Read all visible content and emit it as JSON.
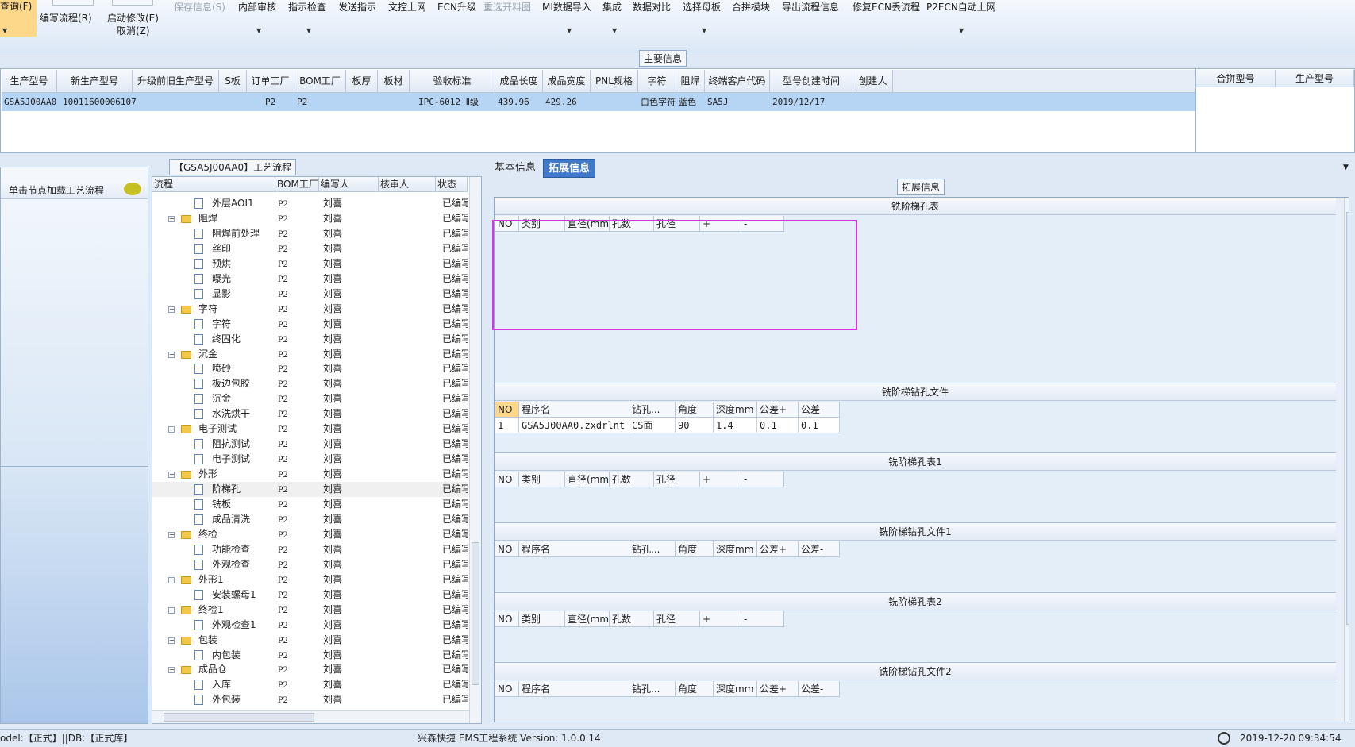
{
  "toolbar": {
    "row1": [
      {
        "label": "查询(F)"
      },
      {
        "label": "编写流程(R)"
      },
      {
        "label": "启动修改(E)"
      },
      {
        "label": "保存信息(S)",
        "disabled": true
      },
      {
        "label": "内部审核"
      },
      {
        "label": "指示检查"
      },
      {
        "label": "发送指示"
      },
      {
        "label": "文控上网"
      },
      {
        "label": "ECN升级"
      },
      {
        "label": "重选开料图",
        "disabled": true
      },
      {
        "label": "MI数据导入"
      },
      {
        "label": "集成"
      },
      {
        "label": "数据对比"
      },
      {
        "label": "选择母板"
      },
      {
        "label": "合拼模块"
      },
      {
        "label": "导出流程信息"
      },
      {
        "label": "修复ECN丢流程"
      },
      {
        "label": "P2ECN自动上网"
      }
    ],
    "cancel": "取消(Z)"
  },
  "main_info": {
    "title": "主要信息",
    "columns": [
      "生产型号",
      "新生产型号",
      "升级前旧生产型号",
      "S板",
      "订单工厂",
      "BOM工厂",
      "板厚",
      "板材",
      "验收标准",
      "成品长度",
      "成品宽度",
      "PNL规格",
      "字符",
      "阻焊",
      "终端客户代码",
      "型号创建时间",
      "创建人"
    ],
    "row": [
      "GSA5J00AA0",
      "10011600006107",
      "",
      "",
      "P2",
      "P2",
      "",
      "",
      "IPC-6012 Ⅱ级",
      "439.96",
      "429.26",
      "",
      "白色字符",
      "蓝色",
      "SA5J",
      "2019/12/17",
      ""
    ],
    "side_columns": [
      "合拼型号",
      "生产型号"
    ]
  },
  "left_panel": {
    "title": "单击节点加载工艺流程"
  },
  "process_tree": {
    "title": "【GSA5J00AA0】工艺流程",
    "columns": [
      "流程",
      "BOM工厂",
      "编写人",
      "核审人",
      "状态"
    ],
    "rows": [
      {
        "type": "doc",
        "name": "外层AOI1",
        "bom": "P2",
        "writer": "刘喜",
        "status": "已编写"
      },
      {
        "type": "folder",
        "name": "阻焊",
        "bom": "P2",
        "writer": "刘喜",
        "status": "已编写"
      },
      {
        "type": "doc",
        "name": "阻焊前处理",
        "bom": "P2",
        "writer": "刘喜",
        "status": "已编写"
      },
      {
        "type": "doc",
        "name": "丝印",
        "bom": "P2",
        "writer": "刘喜",
        "status": "已编写"
      },
      {
        "type": "doc",
        "name": "预烘",
        "bom": "P2",
        "writer": "刘喜",
        "status": "已编写"
      },
      {
        "type": "doc",
        "name": "曝光",
        "bom": "P2",
        "writer": "刘喜",
        "status": "已编写"
      },
      {
        "type": "doc",
        "name": "显影",
        "bom": "P2",
        "writer": "刘喜",
        "status": "已编写"
      },
      {
        "type": "folder",
        "name": "字符",
        "bom": "P2",
        "writer": "刘喜",
        "status": "已编写"
      },
      {
        "type": "doc",
        "name": "字符",
        "bom": "P2",
        "writer": "刘喜",
        "status": "已编写"
      },
      {
        "type": "doc",
        "name": "终固化",
        "bom": "P2",
        "writer": "刘喜",
        "status": "已编写"
      },
      {
        "type": "folder",
        "name": "沉金",
        "bom": "P2",
        "writer": "刘喜",
        "status": "已编写"
      },
      {
        "type": "doc",
        "name": "喷砂",
        "bom": "P2",
        "writer": "刘喜",
        "status": "已编写"
      },
      {
        "type": "doc",
        "name": "板边包胶",
        "bom": "P2",
        "writer": "刘喜",
        "status": "已编写"
      },
      {
        "type": "doc",
        "name": "沉金",
        "bom": "P2",
        "writer": "刘喜",
        "status": "已编写"
      },
      {
        "type": "doc",
        "name": "水洗烘干",
        "bom": "P2",
        "writer": "刘喜",
        "status": "已编写"
      },
      {
        "type": "folder",
        "name": "电子测试",
        "bom": "P2",
        "writer": "刘喜",
        "status": "已编写"
      },
      {
        "type": "doc",
        "name": "阻抗测试",
        "bom": "P2",
        "writer": "刘喜",
        "status": "已编写"
      },
      {
        "type": "doc",
        "name": "电子测试",
        "bom": "P2",
        "writer": "刘喜",
        "status": "已编写"
      },
      {
        "type": "folder",
        "name": "外形",
        "bom": "P2",
        "writer": "刘喜",
        "status": "已编写"
      },
      {
        "type": "doc",
        "name": "阶梯孔",
        "bom": "P2",
        "writer": "刘喜",
        "status": "已编写",
        "selected": true
      },
      {
        "type": "doc",
        "name": "铣板",
        "bom": "P2",
        "writer": "刘喜",
        "status": "已编写"
      },
      {
        "type": "doc",
        "name": "成品清洗",
        "bom": "P2",
        "writer": "刘喜",
        "status": "已编写"
      },
      {
        "type": "folder",
        "name": "终检",
        "bom": "P2",
        "writer": "刘喜",
        "status": "已编写"
      },
      {
        "type": "doc",
        "name": "功能检查",
        "bom": "P2",
        "writer": "刘喜",
        "status": "已编写"
      },
      {
        "type": "doc",
        "name": "外观检查",
        "bom": "P2",
        "writer": "刘喜",
        "status": "已编写"
      },
      {
        "type": "folder",
        "name": "外形1",
        "bom": "P2",
        "writer": "刘喜",
        "status": "已编写"
      },
      {
        "type": "doc",
        "name": "安装螺母1",
        "bom": "P2",
        "writer": "刘喜",
        "status": "已编写"
      },
      {
        "type": "folder",
        "name": "终检1",
        "bom": "P2",
        "writer": "刘喜",
        "status": "已编写"
      },
      {
        "type": "doc",
        "name": "外观检查1",
        "bom": "P2",
        "writer": "刘喜",
        "status": "已编写"
      },
      {
        "type": "folder",
        "name": "包装",
        "bom": "P2",
        "writer": "刘喜",
        "status": "已编写"
      },
      {
        "type": "doc",
        "name": "内包装",
        "bom": "P2",
        "writer": "刘喜",
        "status": "已编写"
      },
      {
        "type": "folder",
        "name": "成品仓",
        "bom": "P2",
        "writer": "刘喜",
        "status": "已编写"
      },
      {
        "type": "doc",
        "name": "入库",
        "bom": "P2",
        "writer": "刘喜",
        "status": "已编写"
      },
      {
        "type": "doc",
        "name": "外包装",
        "bom": "P2",
        "writer": "刘喜",
        "status": "已编写"
      }
    ]
  },
  "tabs": [
    {
      "label": "基本信息",
      "active": false
    },
    {
      "label": "拓展信息",
      "active": true
    }
  ],
  "ext_info": {
    "title": "拓展信息",
    "hole_cols": [
      "NO",
      "类别",
      "直径(mm)",
      "孔数",
      "孔径",
      "+",
      "-"
    ],
    "drill_cols": [
      "NO",
      "程序名",
      "钻孔...",
      "角度",
      "深度mm",
      "公差+",
      "公差-"
    ],
    "sections": [
      {
        "title": "铣阶梯孔表",
        "kind": "hole",
        "rows": []
      },
      {
        "title": "铣阶梯钻孔文件",
        "kind": "drill",
        "rows": [
          [
            "1",
            "GSA5J00AA0.zxdrlnt",
            "CS面",
            "90",
            "1.4",
            "0.1",
            "0.1"
          ]
        ]
      },
      {
        "title": "铣阶梯孔表1",
        "kind": "hole",
        "rows": []
      },
      {
        "title": "铣阶梯钻孔文件1",
        "kind": "drill",
        "rows": []
      },
      {
        "title": "铣阶梯孔表2",
        "kind": "hole",
        "rows": []
      },
      {
        "title": "铣阶梯钻孔文件2",
        "kind": "drill",
        "rows": []
      }
    ]
  },
  "status_bar": {
    "mode": "odel:【正式】||DB:【正式库】",
    "app": "兴森快捷 EMS工程系统 Version: 1.0.0.14",
    "time": "2019-12-20 09:34:54"
  },
  "colors": {
    "accent": "#3f79c7",
    "selection": "#b6d4f3",
    "highlight": "#d633e6"
  }
}
